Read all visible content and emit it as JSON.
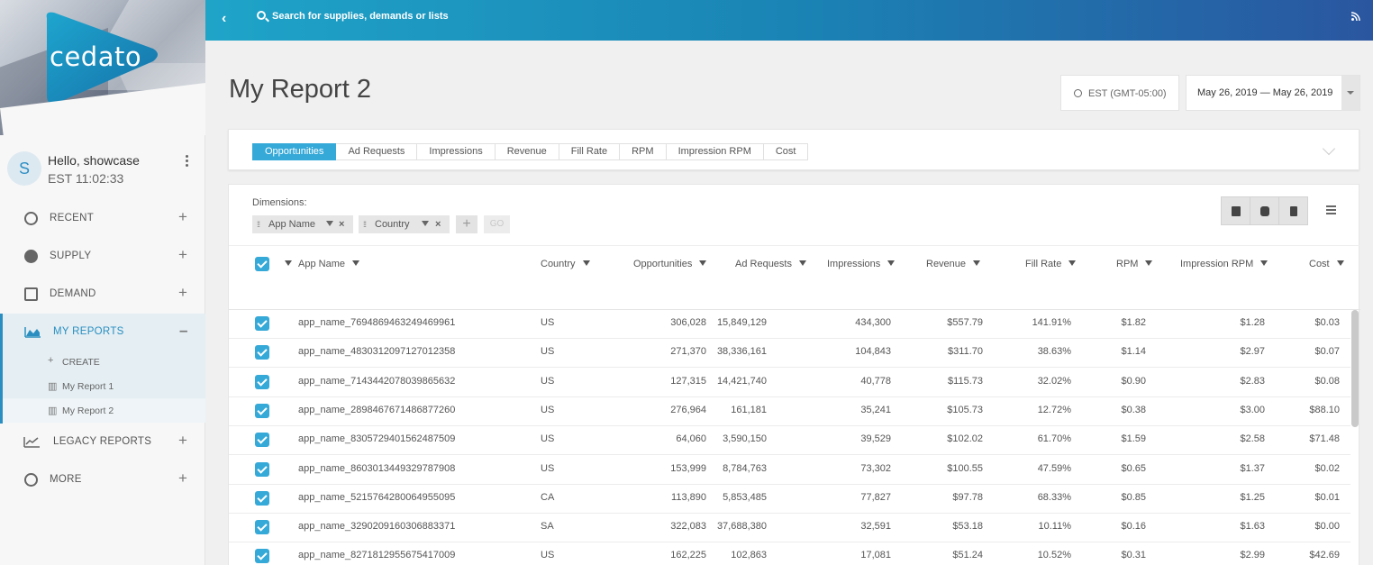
{
  "brand": {
    "logo_text": "cedato"
  },
  "user": {
    "initial": "S",
    "greeting": "Hello, showcase",
    "clock": "EST 11:02:33"
  },
  "nav": {
    "recent": "RECENT",
    "supply": "SUPPLY",
    "demand": "DEMAND",
    "my_reports": "MY REPORTS",
    "create": "CREATE",
    "report1": "My Report 1",
    "report2": "My Report 2",
    "legacy": "LEGACY REPORTS",
    "more": "MORE"
  },
  "topbar": {
    "search_placeholder": "Search for supplies, demands or lists"
  },
  "page": {
    "title": "My Report 2",
    "timezone": "EST (GMT-05:00)",
    "date_range": "May 26, 2019 — May 26, 2019"
  },
  "metrics_tabs": [
    "Opportunities",
    "Ad Requests",
    "Impressions",
    "Revenue",
    "Fill Rate",
    "RPM",
    "Impression RPM",
    "Cost"
  ],
  "dimensions": {
    "label": "Dimensions:",
    "chips": [
      "App Name",
      "Country"
    ],
    "go": "GO"
  },
  "table": {
    "columns": [
      "App Name",
      "Country",
      "Opportunities",
      "Ad Requests",
      "Impressions",
      "Revenue",
      "Fill Rate",
      "RPM",
      "Impression RPM",
      "Cost"
    ],
    "rows": [
      [
        "app_name_7694869463249469961",
        "US",
        "306,028",
        "15,849,129",
        "434,300",
        "$557.79",
        "141.91%",
        "$1.82",
        "$1.28",
        "$0.03"
      ],
      [
        "app_name_4830312097127012358",
        "US",
        "271,370",
        "38,336,161",
        "104,843",
        "$311.70",
        "38.63%",
        "$1.14",
        "$2.97",
        "$0.07"
      ],
      [
        "app_name_7143442078039865632",
        "US",
        "127,315",
        "14,421,740",
        "40,778",
        "$115.73",
        "32.02%",
        "$0.90",
        "$2.83",
        "$0.08"
      ],
      [
        "app_name_2898467671486877260",
        "US",
        "276,964",
        "161,181",
        "35,241",
        "$105.73",
        "12.72%",
        "$0.38",
        "$3.00",
        "$88.10"
      ],
      [
        "app_name_8305729401562487509",
        "US",
        "64,060",
        "3,590,150",
        "39,529",
        "$102.02",
        "61.70%",
        "$1.59",
        "$2.58",
        "$71.48"
      ],
      [
        "app_name_8603013449329787908",
        "US",
        "153,999",
        "8,784,763",
        "73,302",
        "$100.55",
        "47.59%",
        "$0.65",
        "$1.37",
        "$0.02"
      ],
      [
        "app_name_5215764280064955095",
        "CA",
        "113,890",
        "5,853,485",
        "77,827",
        "$97.78",
        "68.33%",
        "$0.85",
        "$1.25",
        "$0.01"
      ],
      [
        "app_name_3290209160306883371",
        "SA",
        "322,083",
        "37,688,380",
        "32,591",
        "$53.18",
        "10.11%",
        "$0.16",
        "$1.63",
        "$0.00"
      ],
      [
        "app_name_8271812955675417009",
        "US",
        "162,225",
        "102,863",
        "17,081",
        "$51.24",
        "10.52%",
        "$0.31",
        "$2.99",
        "$42.69"
      ]
    ]
  },
  "colors": {
    "accent": "#35a9d8",
    "nav_active": "#2a8fc0",
    "topbar_start": "#1fa4c8",
    "topbar_end": "#2a56a0"
  }
}
